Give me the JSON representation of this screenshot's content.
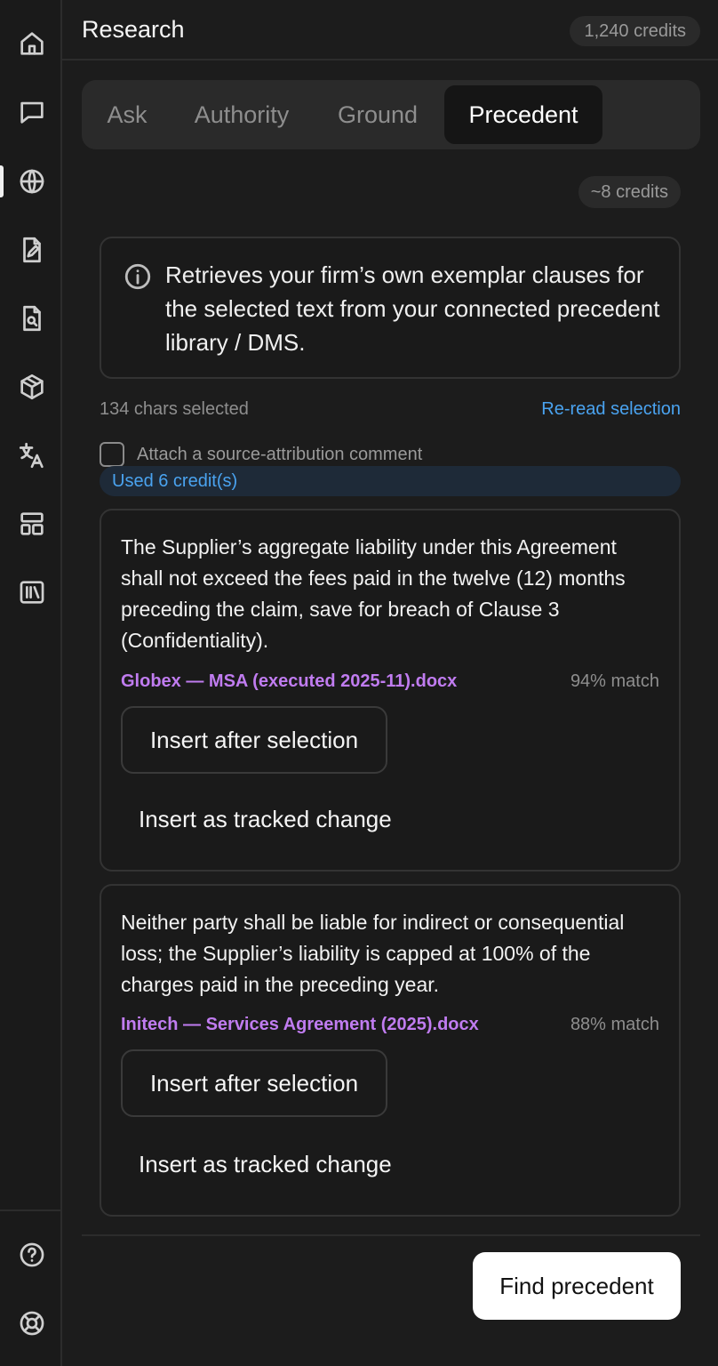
{
  "header": {
    "title": "Research",
    "credits": "1,240 credits"
  },
  "sidebar": {
    "items": [
      {
        "icon": "home-icon"
      },
      {
        "icon": "chat-icon"
      },
      {
        "icon": "globe-icon",
        "active": true
      },
      {
        "icon": "document-edit-icon"
      },
      {
        "icon": "document-search-icon"
      },
      {
        "icon": "cube-icon"
      },
      {
        "icon": "translate-icon"
      },
      {
        "icon": "layout-icon"
      },
      {
        "icon": "library-icon"
      }
    ],
    "bottom": [
      {
        "icon": "help-icon"
      },
      {
        "icon": "lifebuoy-icon"
      }
    ]
  },
  "tabs": [
    {
      "label": "Ask"
    },
    {
      "label": "Authority"
    },
    {
      "label": "Ground"
    },
    {
      "label": "Precedent",
      "active": true
    }
  ],
  "cost": "~8 credits",
  "info": {
    "text": "Retrieves your firm’s own exemplar clauses for the selected text from your connected precedent library / DMS."
  },
  "selection": {
    "count": "134 chars selected",
    "reread": "Re-read selection"
  },
  "attribution": {
    "label": "Attach a source-attribution comment",
    "checked": false
  },
  "usage": "Used 6 credit(s)",
  "results": [
    {
      "text": "The Supplier’s aggregate liability under this Agreement shall not exceed the fees paid in the twelve (12) months preceding the claim, save for breach of Clause 3 (Confidentiality).",
      "source": "Globex — MSA (executed 2025-11).docx",
      "match": "94% match",
      "insert_after": "Insert after selection",
      "insert_tracked": "Insert as tracked change"
    },
    {
      "text": "Neither party shall be liable for indirect or consequential loss; the Supplier’s liability is capped at 100% of the charges paid in the preceding year.",
      "source": "Initech — Services Agreement (2025).docx",
      "match": "88% match",
      "insert_after": "Insert after selection",
      "insert_tracked": "Insert as tracked change"
    }
  ],
  "footer": {
    "primary": "Find precedent"
  },
  "colors": {
    "accent_link": "#4aa3f0",
    "source": "#c07cf0",
    "background": "#1c1c1c"
  }
}
